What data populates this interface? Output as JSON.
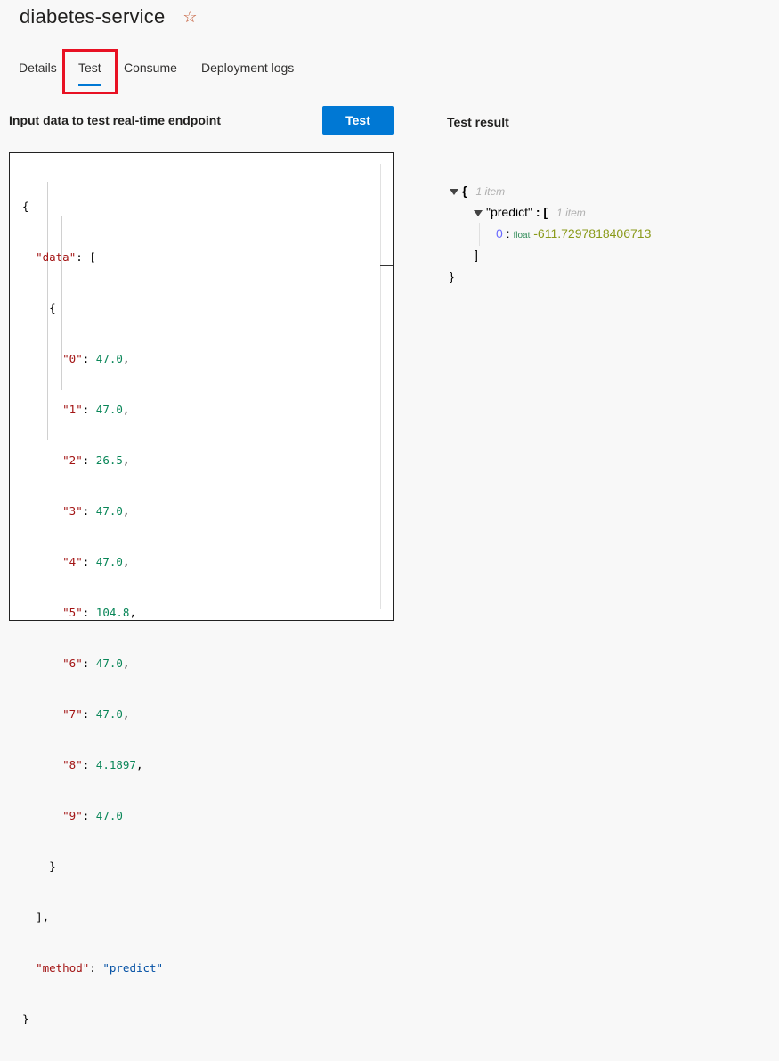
{
  "header": {
    "title": "diabetes-service",
    "star_icon": "star-icon"
  },
  "tabs": [
    {
      "label": "Details"
    },
    {
      "label": "Test"
    },
    {
      "label": "Consume"
    },
    {
      "label": "Deployment logs"
    }
  ],
  "input_section": {
    "title": "Input data to test real-time endpoint",
    "test_button": "Test"
  },
  "editor": {
    "lines": {
      "open": "{",
      "data_key": "\"data\"",
      "data_colon": ": [",
      "obj_open": "{",
      "items": [
        {
          "key": "\"0\"",
          "value": "47.0",
          "sep": ","
        },
        {
          "key": "\"1\"",
          "value": "47.0",
          "sep": ","
        },
        {
          "key": "\"2\"",
          "value": "26.5",
          "sep": ","
        },
        {
          "key": "\"3\"",
          "value": "47.0",
          "sep": ","
        },
        {
          "key": "\"4\"",
          "value": "47.0",
          "sep": ","
        },
        {
          "key": "\"5\"",
          "value": "104.8",
          "sep": ","
        },
        {
          "key": "\"6\"",
          "value": "47.0",
          "sep": ","
        },
        {
          "key": "\"7\"",
          "value": "47.0",
          "sep": ","
        },
        {
          "key": "\"8\"",
          "value": "4.1897",
          "sep": ","
        },
        {
          "key": "\"9\"",
          "value": "47.0",
          "sep": ""
        }
      ],
      "obj_close": "}",
      "arr_close": "],",
      "method_key": "\"method\"",
      "method_colon": ": ",
      "method_value": "\"predict\"",
      "close": "}"
    }
  },
  "result_section": {
    "title": "Test result",
    "root_open": "{",
    "root_count": "1 item",
    "predict_key": "\"predict\"",
    "predict_colon": " : [",
    "predict_count": "1 item",
    "entry_index": "0",
    "entry_colon": " : ",
    "entry_type": "float",
    "entry_value": "-611.7297818406713",
    "arr_close": "]",
    "root_close": "}"
  },
  "colors": {
    "accent": "#0078d4",
    "highlight": "#e81123"
  }
}
